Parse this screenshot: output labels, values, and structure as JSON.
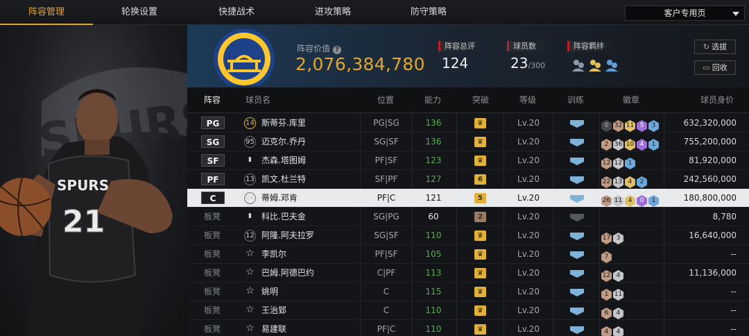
{
  "nav": {
    "tabs": [
      "阵容管理",
      "轮换设置",
      "快捷战术",
      "进攻策略",
      "防守策略"
    ],
    "client_select": "客户专用页"
  },
  "header": {
    "value_label": "阵容价值",
    "value": "2,076,384,780",
    "rating_label": "阵容总评",
    "rating": "124",
    "players_label": "球员数",
    "players": "23",
    "players_max": "/300",
    "bonds_label": "阵容羁绊",
    "pick_button": "选拔",
    "recycle_button": "回收"
  },
  "table": {
    "headers": [
      "阵容",
      "球员名",
      "位置",
      "能力",
      "突破",
      "等级",
      "训练",
      "徽章",
      "球员身价"
    ],
    "rows": [
      {
        "slot": "PG",
        "num": "14",
        "name": "斯蒂芬.库里",
        "pos": "PG|SG",
        "ability": "136",
        "breakthrough": "",
        "level": "Lv.20",
        "badges": [
          [
            "0",
            "dark"
          ],
          [
            "32",
            "bronze"
          ],
          [
            "11",
            "gold"
          ],
          [
            "5",
            "purple"
          ],
          [
            "3",
            "blue"
          ]
        ],
        "value": "632,320,000"
      },
      {
        "slot": "SG",
        "num": "95",
        "name": "迈克尔.乔丹",
        "pos": "SG|SF",
        "ability": "136",
        "breakthrough": "",
        "level": "Lv.20",
        "badges": [
          [
            "2",
            "bronze"
          ],
          [
            "36",
            "silver"
          ],
          [
            "10",
            "gold"
          ],
          [
            "4",
            "purple"
          ],
          [
            "1",
            "blue"
          ]
        ],
        "value": "755,200,000"
      },
      {
        "slot": "SF",
        "num": "",
        "name": "杰森.塔图姆",
        "pos": "PF|SF",
        "ability": "123",
        "breakthrough": "",
        "level": "Lv.20",
        "badges": [
          [
            "12",
            "bronze"
          ],
          [
            "12",
            "silver"
          ],
          [
            "1",
            "blue"
          ]
        ],
        "value": "81,920,000"
      },
      {
        "slot": "PF",
        "num": "13",
        "name": "凯文.杜兰特",
        "pos": "SF|PF",
        "ability": "127",
        "breakthrough": "6",
        "level": "Lv.20",
        "badges": [
          [
            "22",
            "bronze"
          ],
          [
            "13",
            "silver"
          ],
          [
            "4",
            "gold"
          ],
          [
            "2",
            "blue"
          ]
        ],
        "value": "242,560,000"
      },
      {
        "slot": "C",
        "num": "04",
        "name": "蒂姆.邓肯",
        "pos": "PF|C",
        "ability": "121",
        "breakthrough": "5",
        "level": "Lv.20",
        "badges": [
          [
            "26",
            "bronze"
          ],
          [
            "11",
            "silver"
          ],
          [
            "4",
            "gold"
          ],
          [
            "0",
            "purple"
          ],
          [
            "1",
            "blue"
          ]
        ],
        "value": "180,800,000"
      },
      {
        "slot": "板凳",
        "num": "",
        "name": "科比.巴夫金",
        "pos": "SG|PG",
        "ability": "60",
        "breakthrough": "2",
        "level": "Lv.20",
        "badges": [],
        "value": "8,780"
      },
      {
        "slot": "板凳",
        "num": "12",
        "name": "阿隆.阿夫拉罗",
        "pos": "SG|SF",
        "ability": "110",
        "breakthrough": "",
        "level": "Lv.20",
        "badges": [
          [
            "17",
            "bronze"
          ],
          [
            "3",
            "silver"
          ]
        ],
        "value": "16,640,000"
      },
      {
        "slot": "板凳",
        "num": "",
        "name": "李凯尔",
        "pos": "PF|SF",
        "ability": "105",
        "breakthrough": "",
        "level": "Lv.20",
        "badges": [
          [
            "7",
            "bronze"
          ]
        ],
        "value": "--"
      },
      {
        "slot": "板凳",
        "num": "",
        "name": "巴姆.阿德巴约",
        "pos": "C|PF",
        "ability": "113",
        "breakthrough": "",
        "level": "Lv.20",
        "badges": [
          [
            "12",
            "bronze"
          ],
          [
            "4",
            "silver"
          ]
        ],
        "value": "11,136,000"
      },
      {
        "slot": "板凳",
        "num": "",
        "name": "姚明",
        "pos": "C",
        "ability": "115",
        "breakthrough": "",
        "level": "Lv.20",
        "badges": [
          [
            "1",
            "bronze"
          ],
          [
            "11",
            "silver"
          ]
        ],
        "value": "--"
      },
      {
        "slot": "板凳",
        "num": "",
        "name": "王治郅",
        "pos": "C",
        "ability": "110",
        "breakthrough": "",
        "level": "Lv.20",
        "badges": [
          [
            "6",
            "bronze"
          ],
          [
            "4",
            "silver"
          ]
        ],
        "value": "--"
      },
      {
        "slot": "板凳",
        "num": "",
        "name": "易建联",
        "pos": "PF|C",
        "ability": "110",
        "breakthrough": "",
        "level": "Lv.20",
        "badges": [
          [
            "4",
            "bronze"
          ],
          [
            "4",
            "silver"
          ]
        ],
        "value": "--"
      }
    ]
  },
  "colors": {
    "accent": "#e6a531",
    "ability_green": "#56b04e",
    "header_red": "#c21d24"
  },
  "hero": {
    "jersey_text": "SPURS",
    "jersey_number": "21",
    "bg_text": "SPURS"
  }
}
